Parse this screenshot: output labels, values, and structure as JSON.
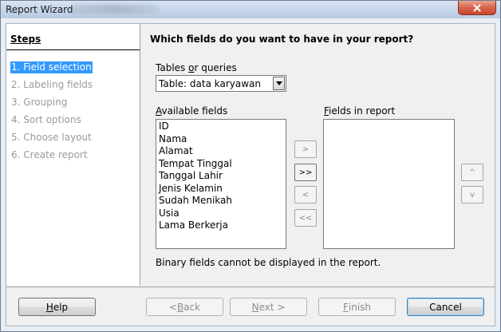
{
  "window": {
    "title": "Report Wizard"
  },
  "steps": {
    "title": "Steps",
    "items": [
      {
        "label": "1. Field selection",
        "active": true
      },
      {
        "label": "2. Labeling fields",
        "active": false
      },
      {
        "label": "3. Grouping",
        "active": false
      },
      {
        "label": "4. Sort options",
        "active": false
      },
      {
        "label": "5. Choose layout",
        "active": false
      },
      {
        "label": "6. Create report",
        "active": false
      }
    ]
  },
  "main": {
    "title": "Which fields do you want to have in your report?",
    "tables_label_pre": "Tables ",
    "tables_label_underlined": "o",
    "tables_label_post": "r queries",
    "table_selected": "Table: data karyawan",
    "available_label_underlined": "A",
    "available_label_rest": "vailable fields",
    "available_fields": [
      "ID",
      "Nama",
      "Alamat",
      "Tempat Tinggal",
      "Tanggal Lahir",
      "Jenis Kelamin",
      "Sudah Menikah",
      "Usia",
      "Lama Berkerja"
    ],
    "report_label_underlined": "F",
    "report_label_rest": "ields in report",
    "report_fields": [],
    "info": "Binary fields cannot be displayed in the report."
  },
  "move_buttons": {
    "add": ">",
    "add_all": ">>",
    "remove": "<",
    "remove_all": "<<",
    "up": "^",
    "down": "v"
  },
  "footer": {
    "help_underlined": "H",
    "help_rest": "elp",
    "back_pre": "< ",
    "back_underlined": "B",
    "back_rest": "ack",
    "next_underlined": "N",
    "next_rest": "ext >",
    "finish_underlined": "F",
    "finish_rest": "inish",
    "cancel": "Cancel"
  },
  "colors": {
    "active_step_bg": "#3399ff",
    "disabled_text": "#9a9a9a"
  }
}
